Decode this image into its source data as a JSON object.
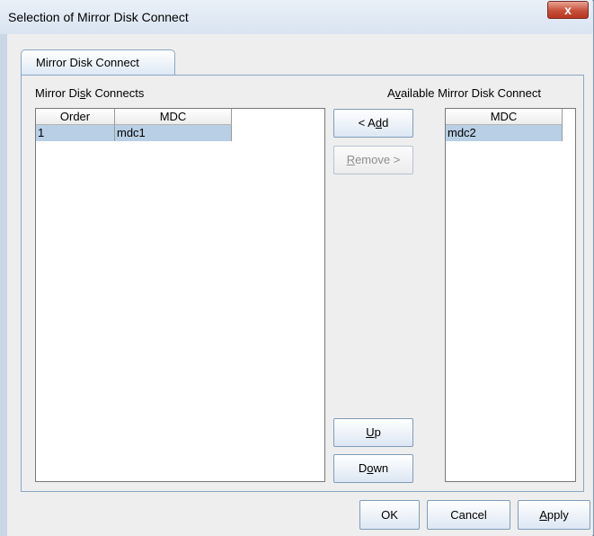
{
  "window": {
    "title": "Selection of Mirror Disk Connect",
    "close_glyph": "x"
  },
  "tab": {
    "label": "Mirror Disk Connect"
  },
  "left_panel": {
    "label_pre": "Mirror Di",
    "label_mn": "s",
    "label_post": "k Connects",
    "columns": [
      "Order",
      "MDC"
    ],
    "rows": [
      {
        "order": "1",
        "mdc": "mdc1",
        "selected": true
      }
    ]
  },
  "right_panel": {
    "label_pre": "A",
    "label_mn": "v",
    "label_post": "ailable Mirror Disk Connect",
    "columns": [
      "MDC"
    ],
    "rows": [
      {
        "mdc": "mdc2",
        "selected": true
      }
    ]
  },
  "buttons": {
    "add": {
      "pre": "< A",
      "mn": "d",
      "post": "d",
      "enabled": true
    },
    "remove": {
      "pre": "",
      "mn": "R",
      "post": "emove >",
      "enabled": false
    },
    "up": {
      "pre": "",
      "mn": "U",
      "post": "p",
      "enabled": true
    },
    "down": {
      "pre": "D",
      "mn": "o",
      "post": "wn",
      "enabled": true
    },
    "ok": {
      "label": "OK"
    },
    "cancel": {
      "label": "Cancel"
    },
    "apply": {
      "pre": "",
      "mn": "A",
      "post": "pply"
    }
  },
  "colors": {
    "selection": "#b8cfe5",
    "close_button": "#c7503b",
    "frame": "#dfe8f2"
  }
}
